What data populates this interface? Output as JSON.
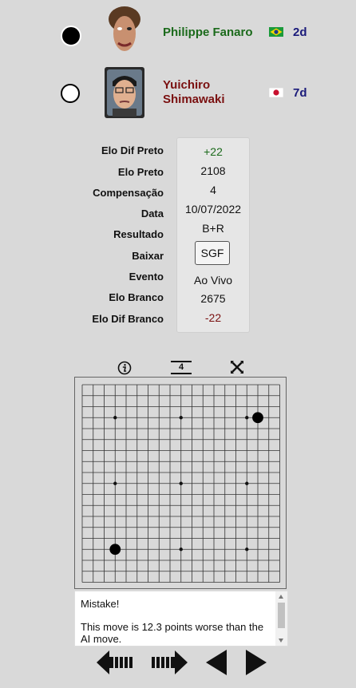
{
  "players": {
    "black": {
      "name": "Philippe Fanaro",
      "rank": "2d",
      "country_flag": "brazil-flag-icon",
      "name_color": "#1b6a1b"
    },
    "white": {
      "name_line1": "Yuichiro",
      "name_line2": "Shimawaki",
      "rank": "7d",
      "country_flag": "japan-flag-icon",
      "name_color": "#7a1010"
    }
  },
  "game_info": {
    "labels": {
      "elo_diff_black": "Elo Dif Preto",
      "elo_black": "Elo Preto",
      "komi": "Compensação",
      "date": "Data",
      "result": "Resultado",
      "download": "Baixar",
      "event": "Evento",
      "elo_white": "Elo Branco",
      "elo_diff_white": "Elo Dif Branco"
    },
    "values": {
      "elo_diff_black": "+22",
      "elo_black": "2108",
      "komi": "4",
      "date": "10/07/2022",
      "result": "B+R",
      "download_button": "SGF",
      "event": "Ao Vivo",
      "elo_white": "2675",
      "elo_diff_white": "-22"
    },
    "colors": {
      "positive": "#1b6a1b",
      "negative": "#7a1010"
    }
  },
  "board_tools": {
    "info": "info-icon",
    "move_number": "4",
    "close": "close-icon"
  },
  "board": {
    "size": 19,
    "stones": [
      {
        "color": "black",
        "col": 16,
        "row": 3
      },
      {
        "color": "black",
        "col": 3,
        "row": 15
      }
    ]
  },
  "comment": {
    "line1": "Mistake!",
    "line2": "This move is 12.3 points worse than the AI move."
  },
  "navigation": {
    "first": "first-move-icon",
    "last": "last-move-icon",
    "previous": "previous-move-icon",
    "next": "next-move-icon"
  }
}
